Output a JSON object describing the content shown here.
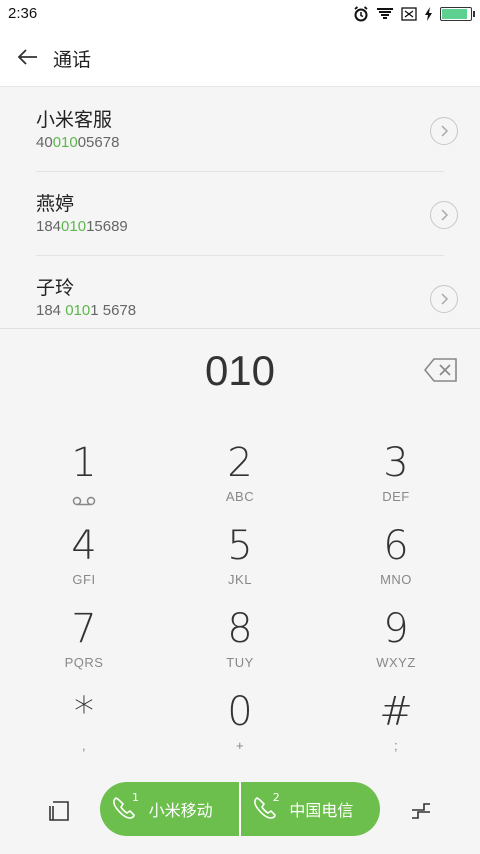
{
  "status": {
    "time": "2:36",
    "battery_level": 0.95,
    "battery_color": "#5cd190"
  },
  "header": {
    "title": "通话"
  },
  "contacts": [
    {
      "name": "小米客服",
      "num_pre": "40",
      "num_hl": "010",
      "num_post": "05678"
    },
    {
      "name": "燕婷",
      "num_pre": "184",
      "num_hl": "010",
      "num_post": "15689"
    },
    {
      "name": "子玲",
      "num_pre": "184 ",
      "num_hl": "010",
      "num_post": "1 5678"
    }
  ],
  "dialer": {
    "input": "010",
    "keys": [
      {
        "digit": "1",
        "letters": "voicemail"
      },
      {
        "digit": "2",
        "letters": "ABC"
      },
      {
        "digit": "3",
        "letters": "DEF"
      },
      {
        "digit": "4",
        "letters": "GFI"
      },
      {
        "digit": "5",
        "letters": "JKL"
      },
      {
        "digit": "6",
        "letters": "MNO"
      },
      {
        "digit": "7",
        "letters": "PQRS"
      },
      {
        "digit": "8",
        "letters": "TUY"
      },
      {
        "digit": "9",
        "letters": "WXYZ"
      },
      {
        "digit": "*",
        "letters": ","
      },
      {
        "digit": "0",
        "letters": "+"
      },
      {
        "digit": "#",
        "letters": ";"
      }
    ]
  },
  "call": {
    "sim1_label": "小米移动",
    "sim1_index": "1",
    "sim2_label": "中国电信",
    "sim2_index": "2",
    "accent_color": "#6cbf4d",
    "highlight_color": "#5bb84a"
  }
}
